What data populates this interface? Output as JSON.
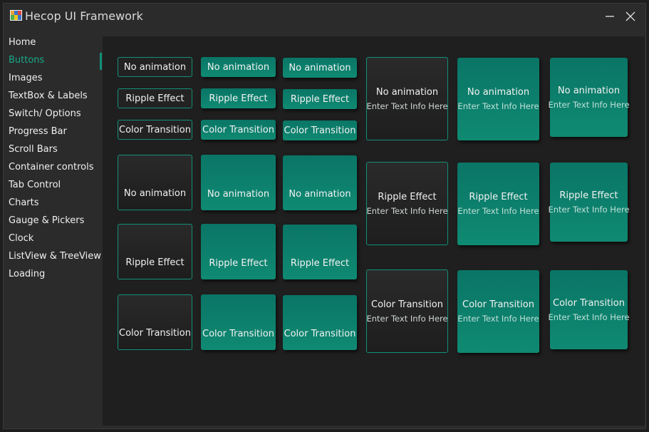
{
  "window": {
    "title": "Hecop UI Framework"
  },
  "sidebar": {
    "items": [
      {
        "label": "Home",
        "active": false
      },
      {
        "label": "Buttons",
        "active": true
      },
      {
        "label": "Images",
        "active": false
      },
      {
        "label": "TextBox & Labels",
        "active": false
      },
      {
        "label": "Switch/ Options",
        "active": false
      },
      {
        "label": "Progress Bar",
        "active": false
      },
      {
        "label": "Scroll Bars",
        "active": false
      },
      {
        "label": "Container controls",
        "active": false
      },
      {
        "label": "Tab Control",
        "active": false
      },
      {
        "label": "Charts",
        "active": false
      },
      {
        "label": "Gauge & Pickers",
        "active": false
      },
      {
        "label": "Clock",
        "active": false
      },
      {
        "label": "ListView & TreeView",
        "active": false
      },
      {
        "label": "Loading",
        "active": false
      }
    ]
  },
  "buttons": {
    "small": [
      "No animation",
      "Ripple Effect",
      "Color Transition"
    ],
    "square": [
      "No animation",
      "Ripple Effect",
      "Color Transition"
    ],
    "cards": [
      {
        "title": "No animation",
        "subtitle": "Enter Text Info Here"
      },
      {
        "title": "Ripple Effect",
        "subtitle": "Enter Text Info Here"
      },
      {
        "title": "Color Transition",
        "subtitle": "Enter Text Info Here"
      }
    ]
  },
  "colors": {
    "accent": "#129079",
    "active_text": "#18a98a",
    "background": "#1f1f1f",
    "sidebar": "#2b2b2b"
  }
}
